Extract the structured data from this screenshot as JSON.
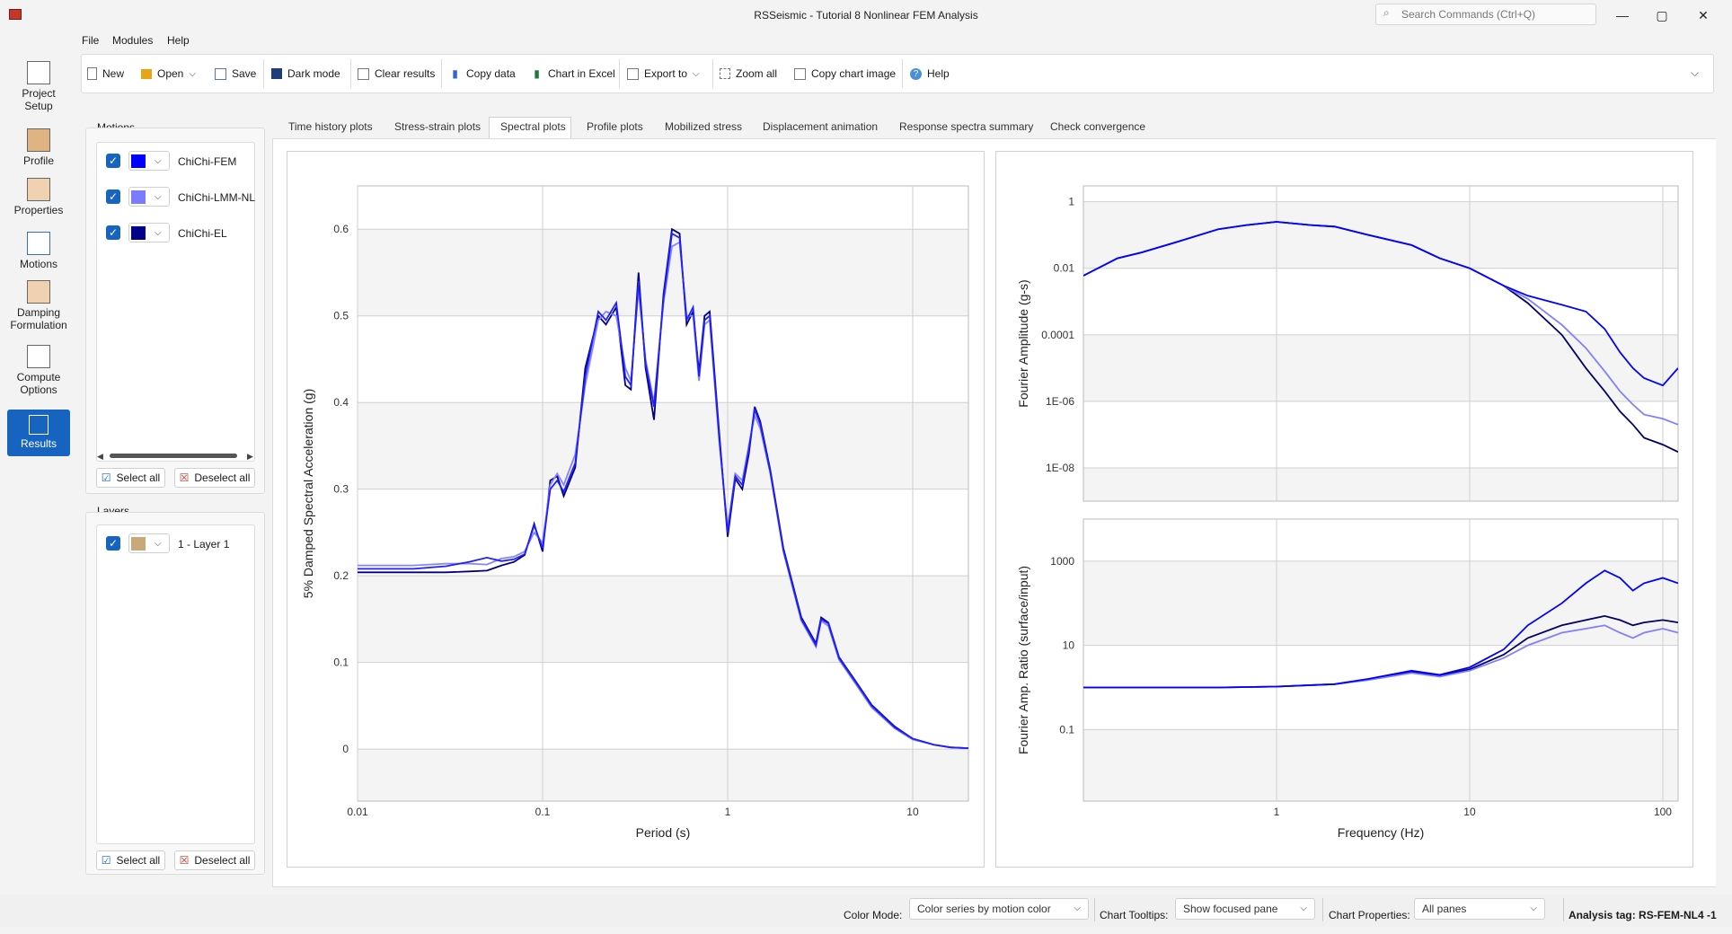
{
  "window": {
    "title": "RSSeismic - Tutorial 8 Nonlinear FEM Analysis",
    "search_placeholder": "Search Commands (Ctrl+Q)",
    "minimize": "—",
    "maximize": "▢",
    "close": "✕"
  },
  "menu": [
    "File",
    "Modules",
    "Help"
  ],
  "ribbon": {
    "new": "New",
    "open": "Open",
    "save": "Save",
    "dark_mode": "Dark mode",
    "clear_results": "Clear results",
    "copy_data": "Copy data",
    "chart_in_excel": "Chart in Excel",
    "export_to": "Export to",
    "zoom_all": "Zoom all",
    "copy_chart_image": "Copy chart image",
    "help": "Help"
  },
  "nav": [
    {
      "label_1": "Project",
      "label_2": "Setup"
    },
    {
      "label_1": "Profile",
      "label_2": ""
    },
    {
      "label_1": "Properties",
      "label_2": ""
    },
    {
      "label_1": "Motions",
      "label_2": ""
    },
    {
      "label_1": "Damping",
      "label_2": "Formulation"
    },
    {
      "label_1": "Compute",
      "label_2": "Options"
    },
    {
      "label_1": "Results",
      "label_2": ""
    }
  ],
  "motions": {
    "title": "Motions",
    "items": [
      {
        "label": "ChiChi-FEM",
        "color": "#0000ff"
      },
      {
        "label": "ChiChi-LMM-NL",
        "color": "#7b7bff"
      },
      {
        "label": "ChiChi-EL",
        "color": "#00008b"
      }
    ],
    "select_all": "Select all",
    "deselect_all": "Deselect all"
  },
  "layers": {
    "title": "Layers",
    "items": [
      {
        "label": "1 - Layer 1",
        "color": "#c8a97a"
      }
    ],
    "select_all": "Select all",
    "deselect_all": "Deselect all"
  },
  "tabs": [
    "Time history plots",
    "Stress-strain plots",
    "Spectral plots",
    "Profile plots",
    "Mobilized stress",
    "Displacement animation",
    "Response spectra summary",
    "Check convergence"
  ],
  "chart_data": [
    {
      "type": "line",
      "title": "",
      "xlabel": "Period (s)",
      "ylabel": "5% Damped Spectral Acceleration (g)",
      "xscale": "log",
      "xlim": [
        0.01,
        20
      ],
      "ylim": [
        -0.06,
        0.65
      ],
      "xticks": [
        "0.01",
        "0.1",
        "1",
        "10"
      ],
      "yticks": [
        "0",
        "0.1",
        "0.2",
        "0.3",
        "0.4",
        "0.5",
        "0.6"
      ],
      "grid": true,
      "series": [
        {
          "name": "ChiChi-FEM",
          "color": "#2020ff",
          "x": [
            0.01,
            0.02,
            0.03,
            0.04,
            0.05,
            0.06,
            0.07,
            0.08,
            0.09,
            0.1,
            0.11,
            0.12,
            0.13,
            0.15,
            0.17,
            0.2,
            0.22,
            0.25,
            0.28,
            0.3,
            0.33,
            0.36,
            0.4,
            0.45,
            0.5,
            0.55,
            0.6,
            0.65,
            0.7,
            0.75,
            0.8,
            0.9,
            1.0,
            1.1,
            1.2,
            1.3,
            1.4,
            1.5,
            1.7,
            2.0,
            2.5,
            3.0,
            3.2,
            3.5,
            4,
            5,
            6,
            8,
            10,
            13,
            16,
            20
          ],
          "y": [
            0.208,
            0.208,
            0.211,
            0.216,
            0.221,
            0.217,
            0.219,
            0.225,
            0.258,
            0.232,
            0.3,
            0.31,
            0.297,
            0.33,
            0.43,
            0.505,
            0.495,
            0.515,
            0.43,
            0.42,
            0.54,
            0.445,
            0.395,
            0.52,
            0.595,
            0.59,
            0.495,
            0.51,
            0.43,
            0.495,
            0.5,
            0.36,
            0.25,
            0.315,
            0.305,
            0.345,
            0.392,
            0.375,
            0.32,
            0.23,
            0.15,
            0.12,
            0.15,
            0.145,
            0.105,
            0.075,
            0.05,
            0.025,
            0.012,
            0.005,
            0.002,
            0.001
          ]
        },
        {
          "name": "ChiChi-LMM-NL",
          "color": "#8585ff",
          "x": [
            0.01,
            0.02,
            0.03,
            0.04,
            0.05,
            0.06,
            0.07,
            0.08,
            0.09,
            0.1,
            0.11,
            0.12,
            0.13,
            0.15,
            0.17,
            0.2,
            0.22,
            0.25,
            0.28,
            0.3,
            0.33,
            0.36,
            0.4,
            0.45,
            0.5,
            0.55,
            0.6,
            0.65,
            0.7,
            0.75,
            0.8,
            0.9,
            1.0,
            1.1,
            1.2,
            1.3,
            1.4,
            1.5,
            1.7,
            2.0,
            2.5,
            3.0,
            3.2,
            3.5,
            4,
            5,
            6,
            8,
            10,
            13,
            16,
            20
          ],
          "y": [
            0.212,
            0.212,
            0.214,
            0.214,
            0.213,
            0.22,
            0.222,
            0.228,
            0.25,
            0.238,
            0.305,
            0.318,
            0.305,
            0.34,
            0.42,
            0.495,
            0.505,
            0.5,
            0.44,
            0.425,
            0.53,
            0.45,
            0.4,
            0.515,
            0.58,
            0.585,
            0.5,
            0.5,
            0.425,
            0.49,
            0.495,
            0.355,
            0.255,
            0.318,
            0.31,
            0.35,
            0.385,
            0.37,
            0.318,
            0.228,
            0.148,
            0.118,
            0.148,
            0.142,
            0.103,
            0.073,
            0.048,
            0.024,
            0.011,
            0.005,
            0.002,
            0.001
          ]
        },
        {
          "name": "ChiChi-EL",
          "color": "#000080",
          "x": [
            0.01,
            0.02,
            0.03,
            0.04,
            0.05,
            0.06,
            0.07,
            0.08,
            0.09,
            0.1,
            0.11,
            0.12,
            0.13,
            0.15,
            0.17,
            0.2,
            0.22,
            0.25,
            0.28,
            0.3,
            0.33,
            0.36,
            0.4,
            0.45,
            0.5,
            0.55,
            0.6,
            0.65,
            0.7,
            0.75,
            0.8,
            0.9,
            1.0,
            1.1,
            1.2,
            1.3,
            1.4,
            1.5,
            1.7,
            2.0,
            2.5,
            3.0,
            3.2,
            3.5,
            4,
            5,
            6,
            8,
            10,
            13,
            16,
            20
          ],
          "y": [
            0.204,
            0.204,
            0.204,
            0.205,
            0.206,
            0.212,
            0.216,
            0.224,
            0.26,
            0.228,
            0.31,
            0.315,
            0.292,
            0.325,
            0.44,
            0.5,
            0.49,
            0.51,
            0.42,
            0.415,
            0.55,
            0.44,
            0.38,
            0.525,
            0.6,
            0.595,
            0.49,
            0.505,
            0.435,
            0.5,
            0.505,
            0.365,
            0.245,
            0.312,
            0.3,
            0.34,
            0.395,
            0.378,
            0.322,
            0.232,
            0.152,
            0.122,
            0.152,
            0.146,
            0.106,
            0.076,
            0.051,
            0.026,
            0.012,
            0.005,
            0.002,
            0.001
          ]
        }
      ]
    },
    {
      "type": "line",
      "title": "",
      "xlabel": "",
      "ylabel": "Fourier Amplitude (g-s)",
      "xscale": "log",
      "yscale": "log",
      "xlim": [
        0.1,
        120
      ],
      "ylim": [
        1e-09,
        3
      ],
      "xticks": [
        "1",
        "10",
        "100"
      ],
      "yticks": [
        "1",
        "0.01",
        "0.0001",
        "1E-06",
        "1E-08"
      ],
      "grid": true,
      "series": [
        {
          "name": "ChiChi-FEM",
          "color": "#0000ff",
          "x": [
            0.1,
            0.15,
            0.2,
            0.3,
            0.5,
            0.7,
            1,
            1.5,
            2,
            3,
            5,
            7,
            10,
            15,
            20,
            30,
            40,
            50,
            60,
            70,
            80,
            100,
            120
          ],
          "y": [
            0.006,
            0.02,
            0.03,
            0.06,
            0.15,
            0.2,
            0.25,
            0.2,
            0.18,
            0.1,
            0.05,
            0.02,
            0.01,
            0.003,
            0.0015,
            0.0008,
            0.0005,
            0.00015,
            3e-05,
            1e-05,
            5e-06,
            3e-06,
            1e-05
          ]
        },
        {
          "name": "ChiChi-LMM-NL",
          "color": "#8080ff",
          "x": [
            0.1,
            0.15,
            0.2,
            0.3,
            0.5,
            0.7,
            1,
            1.5,
            2,
            3,
            5,
            7,
            10,
            15,
            20,
            30,
            40,
            50,
            60,
            70,
            80,
            100,
            120
          ],
          "y": [
            0.006,
            0.02,
            0.03,
            0.06,
            0.15,
            0.2,
            0.25,
            0.2,
            0.18,
            0.1,
            0.05,
            0.02,
            0.01,
            0.003,
            0.0012,
            0.0002,
            4e-05,
            8e-06,
            2e-06,
            8e-07,
            4e-07,
            3e-07,
            2e-07
          ]
        },
        {
          "name": "ChiChi-EL",
          "color": "#000066",
          "x": [
            0.1,
            0.15,
            0.2,
            0.3,
            0.5,
            0.7,
            1,
            1.5,
            2,
            3,
            5,
            7,
            10,
            15,
            20,
            30,
            40,
            50,
            60,
            70,
            80,
            100,
            120
          ],
          "y": [
            0.006,
            0.02,
            0.03,
            0.06,
            0.15,
            0.2,
            0.25,
            0.2,
            0.18,
            0.1,
            0.05,
            0.02,
            0.01,
            0.003,
            0.0009,
            0.0001,
            1e-05,
            2e-06,
            5e-07,
            2e-07,
            8e-08,
            5e-08,
            3e-08
          ]
        }
      ]
    },
    {
      "type": "line",
      "title": "",
      "xlabel": "Frequency (Hz)",
      "ylabel": "Fourier Amp. Ratio (surface/input)",
      "xscale": "log",
      "yscale": "log",
      "xlim": [
        0.1,
        120
      ],
      "ylim": [
        0.002,
        10000
      ],
      "xticks": [
        "1",
        "10",
        "100"
      ],
      "yticks": [
        "1000",
        "10",
        "0.1"
      ],
      "grid": true,
      "series": [
        {
          "name": "ChiChi-FEM",
          "color": "#0000ff",
          "x": [
            0.1,
            0.5,
            1,
            2,
            3,
            5,
            7,
            10,
            15,
            20,
            30,
            40,
            50,
            60,
            70,
            80,
            100,
            120
          ],
          "y": [
            1,
            1,
            1.05,
            1.2,
            1.6,
            2.5,
            2.0,
            3,
            8,
            30,
            100,
            300,
            600,
            400,
            200,
            300,
            400,
            300
          ]
        },
        {
          "name": "ChiChi-LMM-NL",
          "color": "#8080ff",
          "x": [
            0.1,
            0.5,
            1,
            2,
            3,
            5,
            7,
            10,
            15,
            20,
            30,
            40,
            50,
            60,
            70,
            80,
            100,
            120
          ],
          "y": [
            1,
            1,
            1.05,
            1.2,
            1.5,
            2.2,
            1.8,
            2.5,
            5,
            10,
            20,
            25,
            30,
            20,
            15,
            20,
            25,
            20
          ]
        },
        {
          "name": "ChiChi-EL",
          "color": "#000066",
          "x": [
            0.1,
            0.5,
            1,
            2,
            3,
            5,
            7,
            10,
            15,
            20,
            30,
            40,
            50,
            60,
            70,
            80,
            100,
            120
          ],
          "y": [
            1,
            1,
            1.05,
            1.2,
            1.55,
            2.3,
            1.9,
            2.7,
            6,
            15,
            30,
            40,
            50,
            40,
            30,
            35,
            40,
            35
          ]
        }
      ]
    }
  ],
  "status": {
    "color_mode_label": "Color Mode:",
    "color_mode_value": "Color series by motion color",
    "tooltips_label": "Chart Tooltips:",
    "tooltips_value": "Show focused pane",
    "props_label": "Chart Properties:",
    "props_value": "All panes",
    "analysis_tag": "Analysis tag: RS-FEM-NL4 -1"
  }
}
